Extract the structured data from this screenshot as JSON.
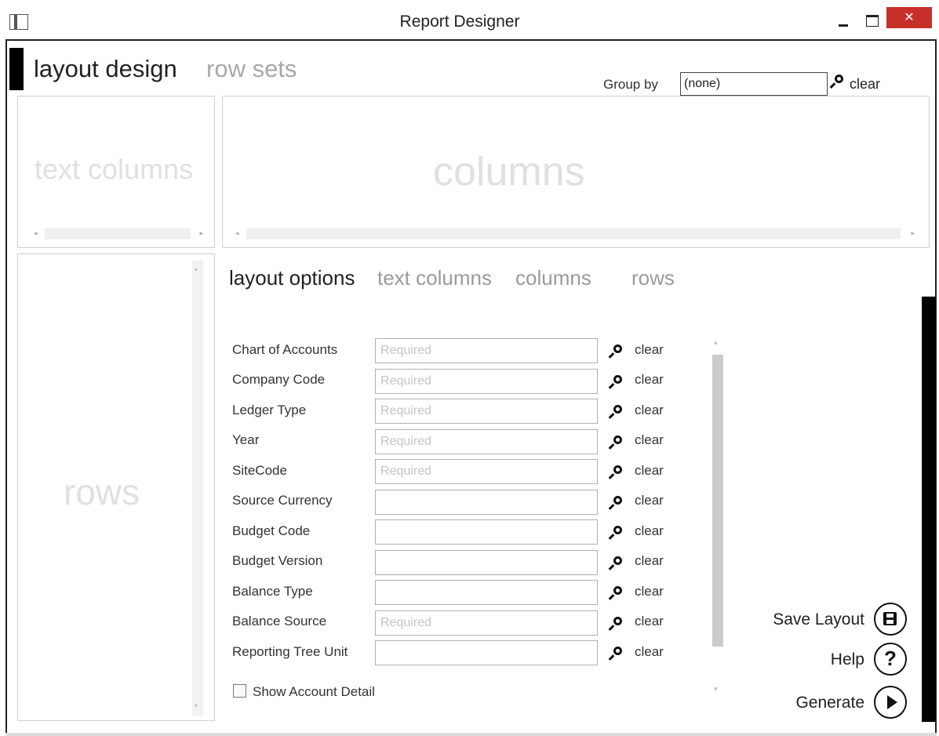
{
  "window": {
    "title": "Report Designer",
    "close_glyph": "✕"
  },
  "main_tabs": {
    "layout_design": "layout design",
    "row_sets": "row sets"
  },
  "group_by": {
    "label": "Group by",
    "value": "(none)",
    "clear": "clear"
  },
  "panels": {
    "text_columns": "text columns",
    "columns": "columns",
    "rows": "rows"
  },
  "sub_tabs": {
    "layout_options": "layout options",
    "text_columns": "text columns",
    "columns": "columns",
    "rows": "rows"
  },
  "fields": [
    {
      "label": "Chart of Accounts",
      "placeholder": "Required",
      "clear": "clear"
    },
    {
      "label": "Company Code",
      "placeholder": "Required",
      "clear": "clear"
    },
    {
      "label": "Ledger Type",
      "placeholder": "Required",
      "clear": "clear"
    },
    {
      "label": "Year",
      "placeholder": "Required",
      "clear": "clear"
    },
    {
      "label": "SiteCode",
      "placeholder": "Required",
      "clear": "clear"
    },
    {
      "label": "Source Currency",
      "placeholder": "",
      "clear": "clear"
    },
    {
      "label": "Budget Code",
      "placeholder": "",
      "clear": "clear"
    },
    {
      "label": "Budget Version",
      "placeholder": "",
      "clear": "clear"
    },
    {
      "label": "Balance Type",
      "placeholder": "",
      "clear": "clear"
    },
    {
      "label": "Balance Source",
      "placeholder": "Required",
      "clear": "clear"
    },
    {
      "label": "Reporting Tree Unit",
      "placeholder": "",
      "clear": "clear"
    }
  ],
  "show_account_detail": {
    "label": "Show Account Detail",
    "checked": false
  },
  "actions": {
    "save_layout": "Save Layout",
    "help": "Help",
    "help_glyph": "?",
    "generate": "Generate"
  },
  "icons": {
    "app": "app-window-icon",
    "search": "search-icon",
    "save": "save-disk-icon",
    "help": "help-circle-icon",
    "generate": "play-circle-icon"
  },
  "colors": {
    "close_button": "#c7302a",
    "accent": "#000000",
    "ghost_text": "#e0e0e0"
  }
}
